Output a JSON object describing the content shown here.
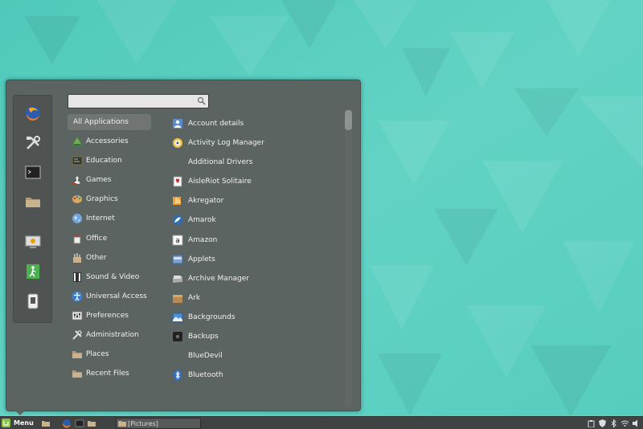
{
  "search": {
    "placeholder": "",
    "value": ""
  },
  "categories": [
    {
      "label": "All Applications",
      "icon": "all-apps",
      "active": true
    },
    {
      "label": "Accessories",
      "icon": "accessories-icon"
    },
    {
      "label": "Education",
      "icon": "education-icon"
    },
    {
      "label": "Games",
      "icon": "games-icon"
    },
    {
      "label": "Graphics",
      "icon": "graphics-icon"
    },
    {
      "label": "Internet",
      "icon": "internet-icon"
    },
    {
      "label": "Office",
      "icon": "office-icon"
    },
    {
      "label": "Other",
      "icon": "other-icon"
    },
    {
      "label": "Sound & Video",
      "icon": "sound-video-icon"
    },
    {
      "label": "Universal Access",
      "icon": "universal-access-icon"
    },
    {
      "label": "Preferences",
      "icon": "preferences-icon"
    },
    {
      "label": "Administration",
      "icon": "administration-icon"
    },
    {
      "label": "Places",
      "icon": "folder-icon"
    },
    {
      "label": "Recent Files",
      "icon": "folder-icon"
    }
  ],
  "apps": [
    {
      "label": "Account details",
      "icon": "account-icon"
    },
    {
      "label": "Activity Log Manager",
      "icon": "activity-log-icon"
    },
    {
      "label": "Additional Drivers",
      "icon": ""
    },
    {
      "label": "AisleRiot Solitaire",
      "icon": "cards-icon"
    },
    {
      "label": "Akregator",
      "icon": "akregator-icon"
    },
    {
      "label": "Amarok",
      "icon": "amarok-icon"
    },
    {
      "label": "Amazon",
      "icon": "amazon-icon"
    },
    {
      "label": "Applets",
      "icon": "applets-icon"
    },
    {
      "label": "Archive Manager",
      "icon": "archive-icon"
    },
    {
      "label": "Ark",
      "icon": "ark-icon"
    },
    {
      "label": "Backgrounds",
      "icon": "backgrounds-icon"
    },
    {
      "label": "Backups",
      "icon": "backups-icon"
    },
    {
      "label": "BlueDevil",
      "icon": ""
    },
    {
      "label": "Bluetooth",
      "icon": "bluetooth-icon"
    }
  ],
  "taskbar": {
    "menu_label": "Menu",
    "window_label": "[Pictures]"
  },
  "colors": {
    "desktop": "#5fd1c2",
    "menu_bg": "#5c605e",
    "panel": "#3f4341",
    "accent_green": "#8bc34a"
  }
}
